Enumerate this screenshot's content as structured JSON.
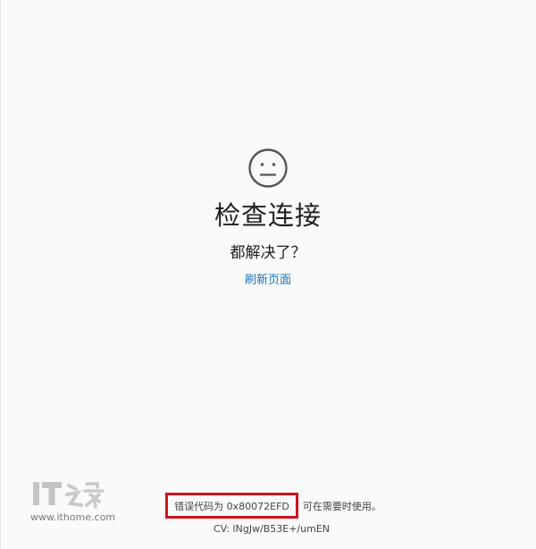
{
  "main": {
    "icon": "neutral-face-icon",
    "title": "检查连接",
    "subtitle": "都解决了？",
    "refresh_link": "刷新页面"
  },
  "footer": {
    "error_label": "错误代码为 0x80072EFD",
    "error_hint": "可在需要时使用。",
    "cv_text": "CV: lNgJw/B53E+/umEN"
  },
  "watermark": {
    "logo_text": "IT之家",
    "url": "www.ithome.com"
  },
  "colors": {
    "background": "#fafafa",
    "link": "#1a73b8",
    "highlight_box": "#d0121c",
    "icon_stroke": "#555555"
  }
}
